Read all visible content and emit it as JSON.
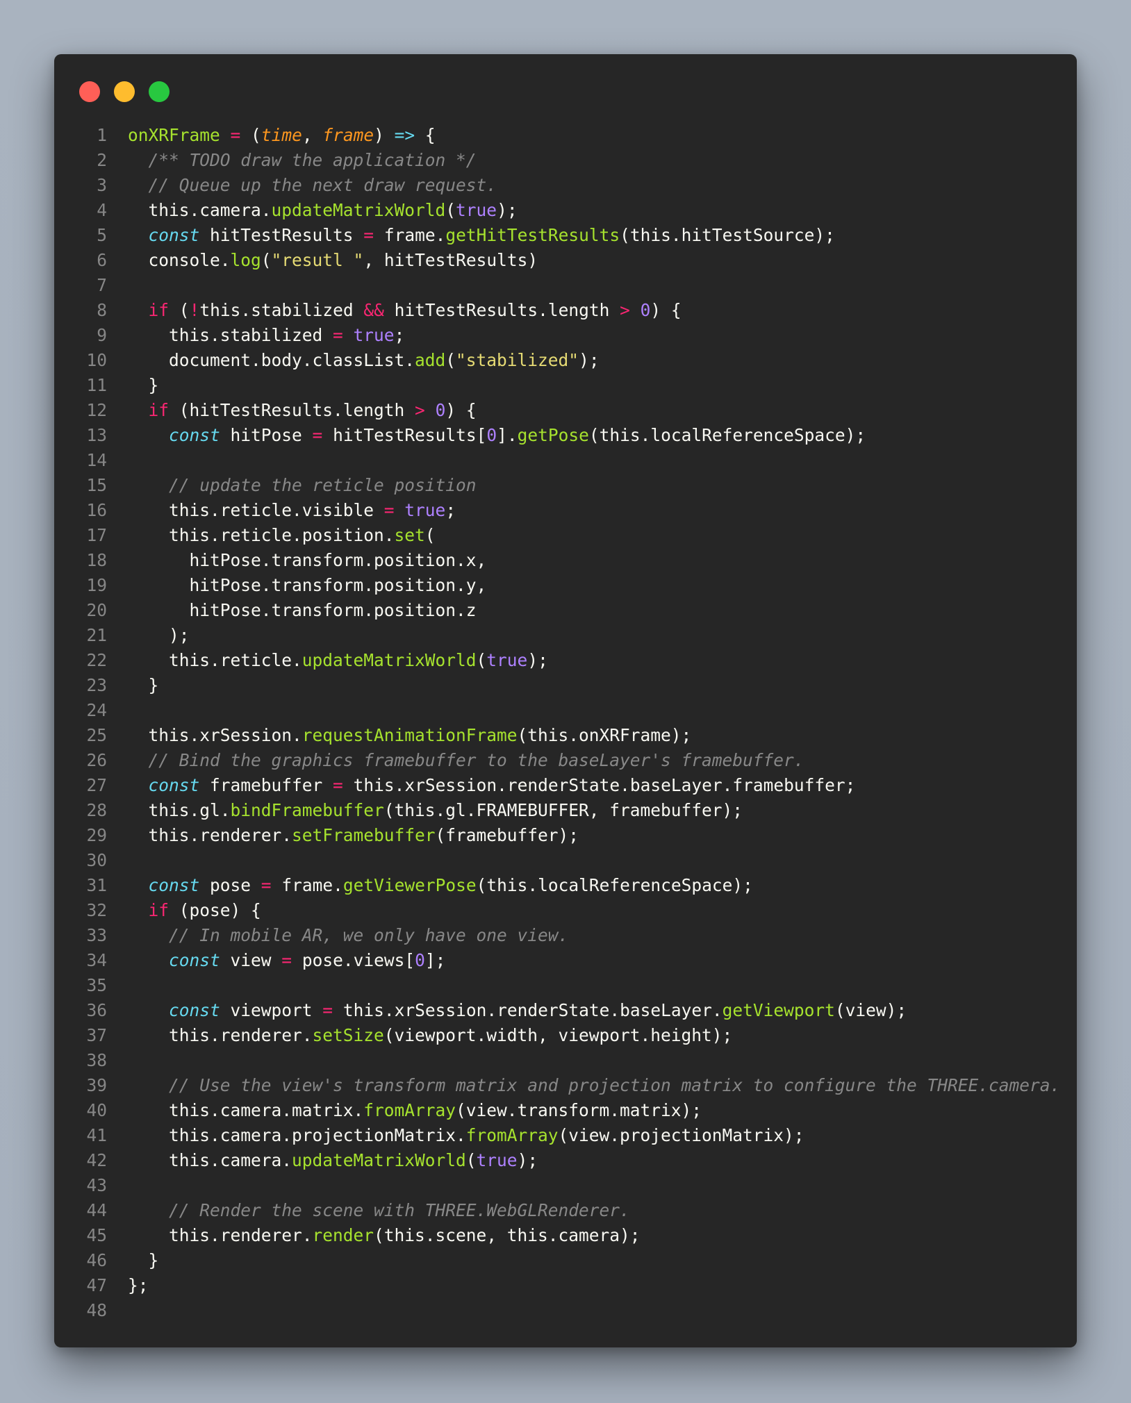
{
  "window": {
    "traffic_lights": [
      {
        "name": "close-button",
        "color": "#ff5f57"
      },
      {
        "name": "minimize-button",
        "color": "#febc2e"
      },
      {
        "name": "zoom-button",
        "color": "#28c840"
      }
    ]
  },
  "colors": {
    "background": "#a9b3bf",
    "editor_background": "#262626",
    "line_number": "#868686",
    "keyword": "#f92672",
    "storage": "#66d9ef",
    "function": "#a6e22e",
    "string": "#e6db74",
    "number": "#ae81ff",
    "parameter": "#fd971f",
    "comment": "#888888",
    "text": "#f8f8f2"
  },
  "code": {
    "lines": [
      {
        "n": "1",
        "tokens": [
          [
            "fn",
            "onXRFrame"
          ],
          [
            "id",
            " "
          ],
          [
            "op",
            "="
          ],
          [
            "id",
            " ("
          ],
          [
            "par",
            "time"
          ],
          [
            "id",
            ", "
          ],
          [
            "par",
            "frame"
          ],
          [
            "id",
            ") "
          ],
          [
            "st",
            "=>"
          ],
          [
            "id",
            " {"
          ]
        ]
      },
      {
        "n": "2",
        "tokens": [
          [
            "id",
            "  "
          ],
          [
            "cm",
            "/** TODO draw the application */"
          ]
        ]
      },
      {
        "n": "3",
        "tokens": [
          [
            "id",
            "  "
          ],
          [
            "cm",
            "// Queue up the next draw request."
          ]
        ]
      },
      {
        "n": "4",
        "tokens": [
          [
            "id",
            "  this.camera."
          ],
          [
            "fn",
            "updateMatrixWorld"
          ],
          [
            "id",
            "("
          ],
          [
            "num",
            "true"
          ],
          [
            "id",
            ");"
          ]
        ]
      },
      {
        "n": "5",
        "tokens": [
          [
            "id",
            "  "
          ],
          [
            "st",
            "const"
          ],
          [
            "id",
            " hitTestResults "
          ],
          [
            "op",
            "="
          ],
          [
            "id",
            " frame."
          ],
          [
            "fn",
            "getHitTestResults"
          ],
          [
            "id",
            "(this.hitTestSource);"
          ]
        ]
      },
      {
        "n": "6",
        "tokens": [
          [
            "id",
            "  console."
          ],
          [
            "fn",
            "log"
          ],
          [
            "id",
            "("
          ],
          [
            "str",
            "\"resutl \""
          ],
          [
            "id",
            ", hitTestResults)"
          ]
        ]
      },
      {
        "n": "7",
        "tokens": []
      },
      {
        "n": "8",
        "tokens": [
          [
            "id",
            "  "
          ],
          [
            "kw",
            "if"
          ],
          [
            "id",
            " ("
          ],
          [
            "op",
            "!"
          ],
          [
            "id",
            "this.stabilized "
          ],
          [
            "op",
            "&&"
          ],
          [
            "id",
            " hitTestResults.length "
          ],
          [
            "op",
            ">"
          ],
          [
            "id",
            " "
          ],
          [
            "num",
            "0"
          ],
          [
            "id",
            ") {"
          ]
        ]
      },
      {
        "n": "9",
        "tokens": [
          [
            "id",
            "    this.stabilized "
          ],
          [
            "op",
            "="
          ],
          [
            "id",
            " "
          ],
          [
            "num",
            "true"
          ],
          [
            "id",
            ";"
          ]
        ]
      },
      {
        "n": "10",
        "tokens": [
          [
            "id",
            "    document.body.classList."
          ],
          [
            "fn",
            "add"
          ],
          [
            "id",
            "("
          ],
          [
            "str",
            "\"stabilized\""
          ],
          [
            "id",
            ");"
          ]
        ]
      },
      {
        "n": "11",
        "tokens": [
          [
            "id",
            "  }"
          ]
        ]
      },
      {
        "n": "12",
        "tokens": [
          [
            "id",
            "  "
          ],
          [
            "kw",
            "if"
          ],
          [
            "id",
            " (hitTestResults.length "
          ],
          [
            "op",
            ">"
          ],
          [
            "id",
            " "
          ],
          [
            "num",
            "0"
          ],
          [
            "id",
            ") {"
          ]
        ]
      },
      {
        "n": "13",
        "tokens": [
          [
            "id",
            "    "
          ],
          [
            "st",
            "const"
          ],
          [
            "id",
            " hitPose "
          ],
          [
            "op",
            "="
          ],
          [
            "id",
            " hitTestResults["
          ],
          [
            "num",
            "0"
          ],
          [
            "id",
            "]."
          ],
          [
            "fn",
            "getPose"
          ],
          [
            "id",
            "(this.localReferenceSpace);"
          ]
        ]
      },
      {
        "n": "14",
        "tokens": []
      },
      {
        "n": "15",
        "tokens": [
          [
            "id",
            "    "
          ],
          [
            "cm",
            "// update the reticle position"
          ]
        ]
      },
      {
        "n": "16",
        "tokens": [
          [
            "id",
            "    this.reticle.visible "
          ],
          [
            "op",
            "="
          ],
          [
            "id",
            " "
          ],
          [
            "num",
            "true"
          ],
          [
            "id",
            ";"
          ]
        ]
      },
      {
        "n": "17",
        "tokens": [
          [
            "id",
            "    this.reticle.position."
          ],
          [
            "fn",
            "set"
          ],
          [
            "id",
            "("
          ]
        ]
      },
      {
        "n": "18",
        "tokens": [
          [
            "id",
            "      hitPose.transform.position.x,"
          ]
        ]
      },
      {
        "n": "19",
        "tokens": [
          [
            "id",
            "      hitPose.transform.position.y,"
          ]
        ]
      },
      {
        "n": "20",
        "tokens": [
          [
            "id",
            "      hitPose.transform.position.z"
          ]
        ]
      },
      {
        "n": "21",
        "tokens": [
          [
            "id",
            "    );"
          ]
        ]
      },
      {
        "n": "22",
        "tokens": [
          [
            "id",
            "    this.reticle."
          ],
          [
            "fn",
            "updateMatrixWorld"
          ],
          [
            "id",
            "("
          ],
          [
            "num",
            "true"
          ],
          [
            "id",
            ");"
          ]
        ]
      },
      {
        "n": "23",
        "tokens": [
          [
            "id",
            "  }"
          ]
        ]
      },
      {
        "n": "24",
        "tokens": []
      },
      {
        "n": "25",
        "tokens": [
          [
            "id",
            "  this.xrSession."
          ],
          [
            "fn",
            "requestAnimationFrame"
          ],
          [
            "id",
            "(this.onXRFrame);"
          ]
        ]
      },
      {
        "n": "26",
        "tokens": [
          [
            "id",
            "  "
          ],
          [
            "cm",
            "// Bind the graphics framebuffer to the baseLayer's framebuffer."
          ]
        ]
      },
      {
        "n": "27",
        "tokens": [
          [
            "id",
            "  "
          ],
          [
            "st",
            "const"
          ],
          [
            "id",
            " framebuffer "
          ],
          [
            "op",
            "="
          ],
          [
            "id",
            " this.xrSession.renderState.baseLayer.framebuffer;"
          ]
        ]
      },
      {
        "n": "28",
        "tokens": [
          [
            "id",
            "  this.gl."
          ],
          [
            "fn",
            "bindFramebuffer"
          ],
          [
            "id",
            "(this.gl.FRAMEBUFFER, framebuffer);"
          ]
        ]
      },
      {
        "n": "29",
        "tokens": [
          [
            "id",
            "  this.renderer."
          ],
          [
            "fn",
            "setFramebuffer"
          ],
          [
            "id",
            "(framebuffer);"
          ]
        ]
      },
      {
        "n": "30",
        "tokens": []
      },
      {
        "n": "31",
        "tokens": [
          [
            "id",
            "  "
          ],
          [
            "st",
            "const"
          ],
          [
            "id",
            " pose "
          ],
          [
            "op",
            "="
          ],
          [
            "id",
            " frame."
          ],
          [
            "fn",
            "getViewerPose"
          ],
          [
            "id",
            "(this.localReferenceSpace);"
          ]
        ]
      },
      {
        "n": "32",
        "tokens": [
          [
            "id",
            "  "
          ],
          [
            "kw",
            "if"
          ],
          [
            "id",
            " (pose) {"
          ]
        ]
      },
      {
        "n": "33",
        "tokens": [
          [
            "id",
            "    "
          ],
          [
            "cm",
            "// In mobile AR, we only have one view."
          ]
        ]
      },
      {
        "n": "34",
        "tokens": [
          [
            "id",
            "    "
          ],
          [
            "st",
            "const"
          ],
          [
            "id",
            " view "
          ],
          [
            "op",
            "="
          ],
          [
            "id",
            " pose.views["
          ],
          [
            "num",
            "0"
          ],
          [
            "id",
            "];"
          ]
        ]
      },
      {
        "n": "35",
        "tokens": []
      },
      {
        "n": "36",
        "tokens": [
          [
            "id",
            "    "
          ],
          [
            "st",
            "const"
          ],
          [
            "id",
            " viewport "
          ],
          [
            "op",
            "="
          ],
          [
            "id",
            " this.xrSession.renderState.baseLayer."
          ],
          [
            "fn",
            "getViewport"
          ],
          [
            "id",
            "(view);"
          ]
        ]
      },
      {
        "n": "37",
        "tokens": [
          [
            "id",
            "    this.renderer."
          ],
          [
            "fn",
            "setSize"
          ],
          [
            "id",
            "(viewport.width, viewport.height);"
          ]
        ]
      },
      {
        "n": "38",
        "tokens": []
      },
      {
        "n": "39",
        "tokens": [
          [
            "id",
            "    "
          ],
          [
            "cm",
            "// Use the view's transform matrix and projection matrix to configure the THREE.camera."
          ]
        ]
      },
      {
        "n": "40",
        "tokens": [
          [
            "id",
            "    this.camera.matrix."
          ],
          [
            "fn",
            "fromArray"
          ],
          [
            "id",
            "(view.transform.matrix);"
          ]
        ]
      },
      {
        "n": "41",
        "tokens": [
          [
            "id",
            "    this.camera.projectionMatrix."
          ],
          [
            "fn",
            "fromArray"
          ],
          [
            "id",
            "(view.projectionMatrix);"
          ]
        ]
      },
      {
        "n": "42",
        "tokens": [
          [
            "id",
            "    this.camera."
          ],
          [
            "fn",
            "updateMatrixWorld"
          ],
          [
            "id",
            "("
          ],
          [
            "num",
            "true"
          ],
          [
            "id",
            ");"
          ]
        ]
      },
      {
        "n": "43",
        "tokens": []
      },
      {
        "n": "44",
        "tokens": [
          [
            "id",
            "    "
          ],
          [
            "cm",
            "// Render the scene with THREE.WebGLRenderer."
          ]
        ]
      },
      {
        "n": "45",
        "tokens": [
          [
            "id",
            "    this.renderer."
          ],
          [
            "fn",
            "render"
          ],
          [
            "id",
            "(this.scene, this.camera);"
          ]
        ]
      },
      {
        "n": "46",
        "tokens": [
          [
            "id",
            "  }"
          ]
        ]
      },
      {
        "n": "47",
        "tokens": [
          [
            "id",
            "};"
          ]
        ]
      },
      {
        "n": "48",
        "tokens": []
      }
    ]
  }
}
